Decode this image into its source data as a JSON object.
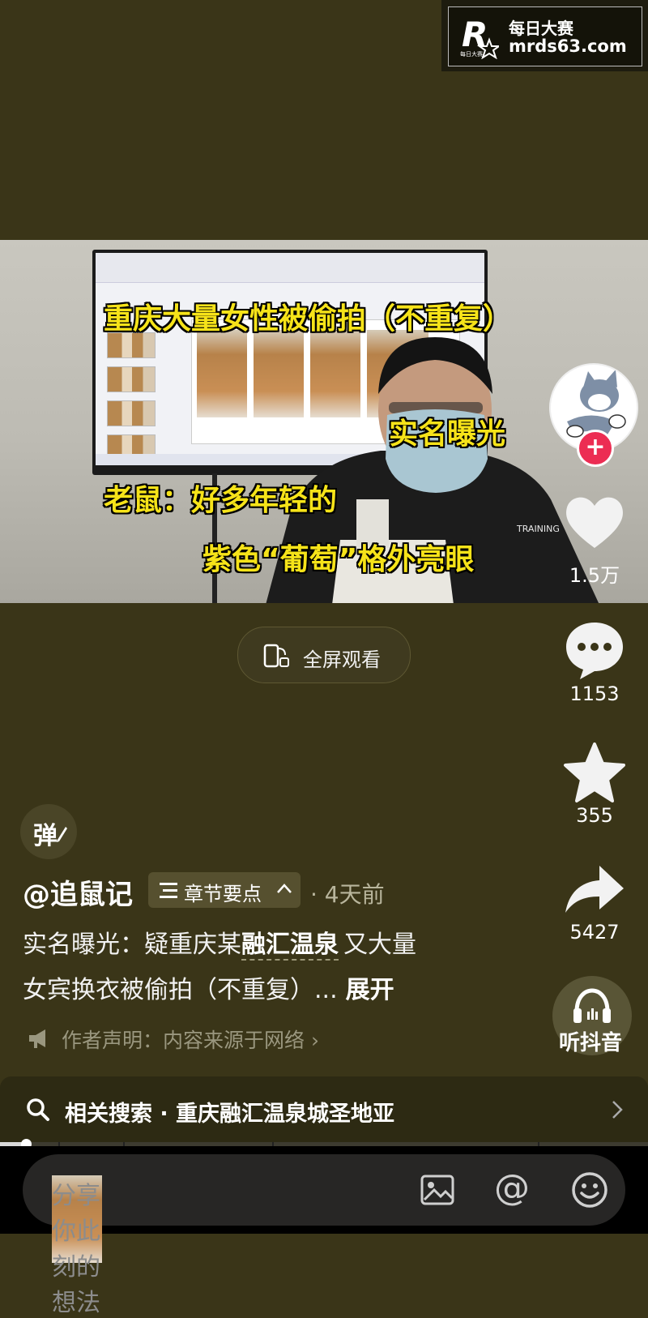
{
  "watermark": {
    "title": "每日大赛",
    "url": "mrds63.com",
    "logo_letter": "R",
    "logo_sub": "每日大赛"
  },
  "video": {
    "captions": {
      "line1": "重庆大量女性被偷拍（不重复）",
      "line2": "实名曝光",
      "line3": "老鼠：好多年轻的",
      "line4": "紫色“葡萄”格外亮眼"
    },
    "shirt_text": "TRAINING"
  },
  "actions": {
    "likes": "1.5万",
    "comments": "1153",
    "favorites": "355",
    "shares": "5427",
    "listen_label": "听抖音"
  },
  "fullscreen_label": "全屏观看",
  "danmu_label": "弹",
  "post": {
    "author": "@追鼠记",
    "chapter_label": "章节要点",
    "time": "· 4天前",
    "desc_prefix": "实名曝光：疑重庆某",
    "desc_highlight": "融汇温泉",
    "desc_suffix": "又大量",
    "desc_line2": "女宾换衣被偷拍（不重复）...",
    "expand_label": "展开",
    "declaration": "作者声明：内容来源于网络 ›"
  },
  "related_search": "相关搜索 · 重庆融汇温泉城圣地亚",
  "progress": {
    "value": 0.04,
    "segments": [
      0.09,
      0.19,
      0.42,
      0.83
    ]
  },
  "comment_placeholder": "分享你此刻的想法",
  "icons": [
    "image-icon",
    "at-icon",
    "emoji-icon",
    "heart-icon",
    "comment-icon",
    "star-icon",
    "share-icon",
    "headphones-icon",
    "search-icon"
  ]
}
